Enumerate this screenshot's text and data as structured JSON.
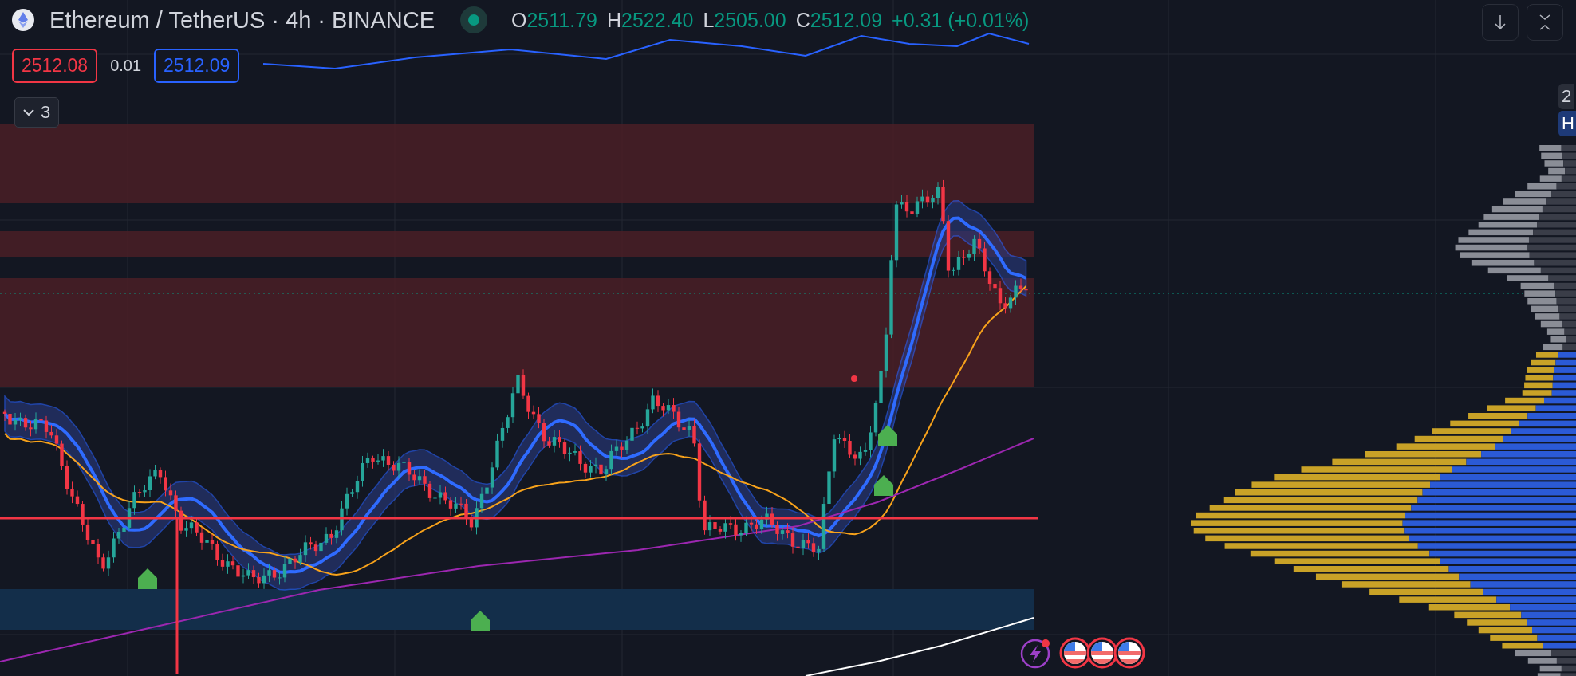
{
  "header": {
    "title": "Ethereum / TetherUS · 4h · BINANCE",
    "ohlc": [
      {
        "label": "O",
        "value": "2511.79"
      },
      {
        "label": "H",
        "value": "2522.40"
      },
      {
        "label": "L",
        "value": "2505.00"
      },
      {
        "label": "C",
        "value": "2512.09"
      }
    ],
    "change": "+0.31 (+0.01%)"
  },
  "order_panel": {
    "sell": "2512.08",
    "spread": "0.01",
    "buy": "2512.09"
  },
  "indicators_toggle": {
    "count": "3"
  },
  "price_scale_labels": [
    "2",
    "H"
  ],
  "events": [
    {
      "kind": "lightning"
    },
    {
      "kind": "flag"
    },
    {
      "kind": "flag"
    },
    {
      "kind": "flag"
    }
  ]
}
